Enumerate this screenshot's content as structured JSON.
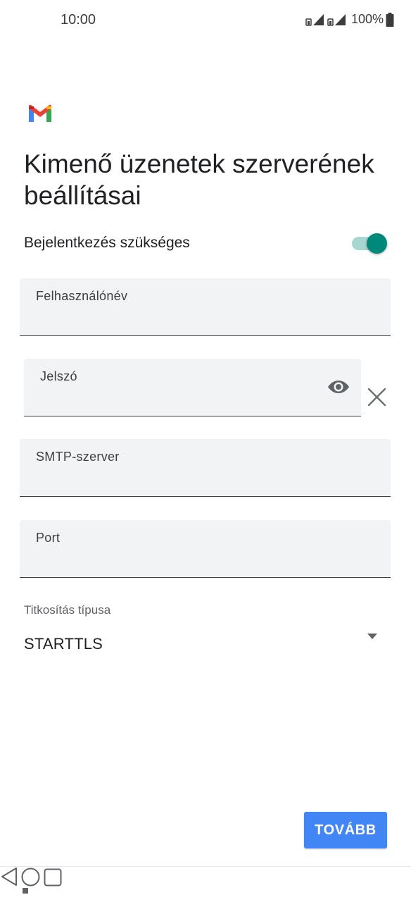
{
  "status_bar": {
    "time": "10:00",
    "battery_percent": "100%",
    "icons": [
      "sim1-signal-icon",
      "sim2-signal-icon",
      "battery-full-icon"
    ]
  },
  "app": {
    "logo": "gmail-logo",
    "title": "Kimenő üzenetek szerverének beállításai"
  },
  "login_required": {
    "label": "Bejelentkezés szükséges",
    "enabled": true
  },
  "fields": {
    "username": {
      "label": "Felhasználónév",
      "value": ""
    },
    "password": {
      "label": "Jelszó",
      "value": ""
    },
    "smtp_server": {
      "label": "SMTP-szerver",
      "value": ""
    },
    "port": {
      "label": "Port",
      "value": ""
    }
  },
  "encryption": {
    "label": "Titkosítás típusa",
    "selected": "STARTTLS"
  },
  "actions": {
    "next_label": "TOVÁBB"
  },
  "colors": {
    "accent": "#4285f4",
    "toggle_on": "#00897b",
    "field_bg": "#f1f3f4"
  },
  "nav": {
    "icons": [
      "nav-dot-icon",
      "back-icon",
      "home-icon",
      "recents-icon"
    ]
  }
}
